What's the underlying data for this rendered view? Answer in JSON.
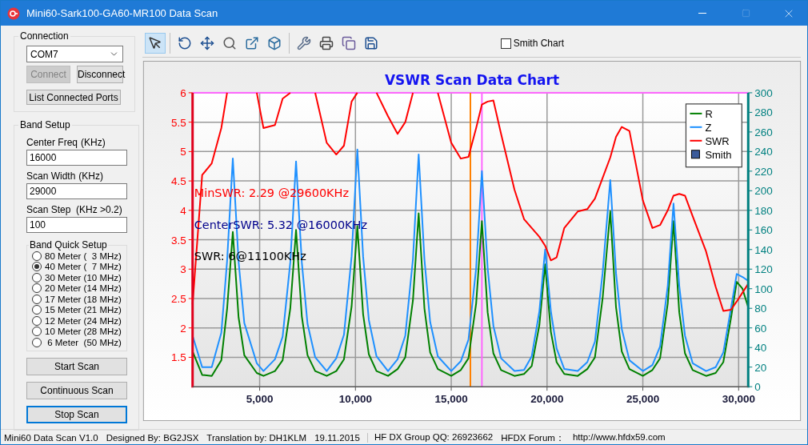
{
  "window": {
    "title": "Mini60-Sark100-GA60-MR100 Data Scan"
  },
  "connection": {
    "title": "Connection",
    "port": "COM7",
    "buttons": [
      {
        "label": "Connect",
        "disabled": true
      },
      {
        "label": "Disconnect",
        "disabled": false
      },
      {
        "label": "List Connected Ports",
        "disabled": false
      }
    ]
  },
  "band_setup": {
    "title": "Band Setup",
    "fields": [
      {
        "label": "Center Freq",
        "unit": "(KHz)",
        "value": "16000"
      },
      {
        "label": "Scan Width",
        "unit": "(KHz)",
        "value": "29000"
      },
      {
        "label": "Scan Step",
        "unit": "(KHz >0.2)",
        "value": "100"
      }
    ],
    "quick_setup": {
      "title": "Band Quick Setup",
      "options": [
        {
          "label": "80 Meter (  3 MHz)",
          "selected": false
        },
        {
          "label": "40 Meter (  7 MHz)",
          "selected": true
        },
        {
          "label": "30 Meter (10 MHz)",
          "selected": false
        },
        {
          "label": "20 Meter (14 MHz)",
          "selected": false
        },
        {
          "label": "17 Meter (18 MHz)",
          "selected": false
        },
        {
          "label": "15 Meter (21 MHz)",
          "selected": false
        },
        {
          "label": "12 Meter (24 MHz)",
          "selected": false
        },
        {
          "label": "10 Meter (28 MHz)",
          "selected": false
        },
        {
          "label": " 6 Meter  (50 MHz)",
          "selected": false
        }
      ]
    },
    "buttons": [
      {
        "label": "Start Scan",
        "focused": false
      },
      {
        "label": "Continuous Scan",
        "focused": false
      },
      {
        "label": "Stop Scan",
        "focused": true
      }
    ]
  },
  "toolbar": {
    "tools": [
      {
        "kind": "pointer",
        "selected": true
      },
      {
        "kind": "rotate",
        "selected": false
      },
      {
        "kind": "move",
        "selected": false
      },
      {
        "kind": "zoom",
        "selected": false
      },
      {
        "kind": "box-arrow",
        "selected": false
      },
      {
        "kind": "box",
        "selected": false
      },
      {
        "kind": "tools",
        "selected": false
      },
      {
        "kind": "print",
        "selected": false
      },
      {
        "kind": "copy",
        "selected": false
      },
      {
        "kind": "save",
        "selected": false
      }
    ],
    "smith_chart": {
      "label": "Smith Chart",
      "checked": false
    }
  },
  "chart": {
    "legend_extra": [
      {
        "label": "Smith",
        "color": "#3b5b9a"
      }
    ],
    "annotation_styles": [
      {
        "color": "#ff0000"
      },
      {
        "color": "#00008b"
      },
      {
        "color": "#000000"
      }
    ],
    "chart_data": {
      "type": "line",
      "title": "VSWR Scan Data Chart",
      "grid": true,
      "legend": "upper right",
      "ref_lines": [
        {
          "axis": "y",
          "value": 6,
          "color": "#ff66ff"
        },
        {
          "axis": "x",
          "value": 16000,
          "color": "#ff8000"
        },
        {
          "axis": "x",
          "value": 16600,
          "color": "#ff66ff"
        }
      ],
      "xlim": [
        1500,
        30500
      ],
      "ylim": [
        1,
        6
      ],
      "y2lim": [
        0,
        300
      ],
      "xticks": [
        {
          "value": 5000,
          "label": "5,000"
        },
        {
          "value": 10000,
          "label": "10,000"
        },
        {
          "value": 15000,
          "label": "15,000"
        },
        {
          "value": 20000,
          "label": "20,000"
        },
        {
          "value": 25000,
          "label": "25,000"
        },
        {
          "value": 30000,
          "label": "30,000"
        }
      ],
      "yticks": [
        1.5,
        2,
        2.5,
        3,
        3.5,
        4,
        4.5,
        5,
        5.5,
        6
      ],
      "y2ticks": [
        0,
        20,
        40,
        60,
        80,
        100,
        120,
        140,
        160,
        180,
        200,
        220,
        240,
        260,
        280,
        300
      ],
      "x": [
        1500,
        2000,
        2500,
        3000,
        3300,
        3600,
        3900,
        4200,
        4850,
        5200,
        5800,
        6200,
        6600,
        6900,
        7200,
        7500,
        7900,
        8500,
        9000,
        9400,
        9800,
        10100,
        10400,
        10700,
        11100,
        11700,
        12200,
        12600,
        13000,
        13300,
        13600,
        13900,
        14300,
        15000,
        15500,
        15900,
        16300,
        16600,
        16900,
        17200,
        17600,
        18300,
        18800,
        19200,
        19600,
        19900,
        20200,
        20500,
        20900,
        21600,
        22100,
        22500,
        22900,
        23300,
        23600,
        23900,
        24300,
        25000,
        25500,
        25900,
        26300,
        26600,
        26900,
        27200,
        27600,
        28300,
        28800,
        29200,
        29600,
        29900,
        30200,
        30500
      ],
      "series": [
        {
          "name": "R",
          "color": "#008000",
          "axis": "y2",
          "values": [
            36,
            12,
            11,
            27,
            79,
            158,
            71,
            32,
            14,
            11,
            16,
            27,
            80,
            160,
            72,
            32,
            16,
            11,
            16,
            28,
            82,
            164,
            74,
            33,
            16,
            11,
            18,
            30,
            88,
            177,
            80,
            35,
            18,
            11,
            17,
            29,
            85,
            169,
            76,
            34,
            17,
            11,
            13,
            21,
            63,
            125,
            56,
            25,
            13,
            11,
            18,
            30,
            90,
            179,
            81,
            36,
            18,
            11,
            17,
            29,
            85,
            169,
            76,
            34,
            17,
            11,
            14,
            25,
            70,
            107,
            100,
            81
          ]
        },
        {
          "name": "Z",
          "color": "#1e90ff",
          "axis": "y2",
          "values": [
            52,
            20,
            20,
            55,
            128,
            233,
            128,
            65,
            24,
            16,
            28,
            51,
            127,
            230,
            127,
            64,
            30,
            16,
            29,
            53,
            133,
            242,
            133,
            68,
            31,
            16,
            28,
            52,
            130,
            237,
            130,
            66,
            31,
            16,
            26,
            48,
            121,
            220,
            121,
            62,
            29,
            16,
            17,
            31,
            77,
            140,
            77,
            39,
            18,
            16,
            25,
            46,
            116,
            211,
            116,
            59,
            27,
            16,
            22,
            41,
            103,
            187,
            103,
            52,
            24,
            16,
            20,
            35,
            80,
            115,
            112,
            108
          ]
        },
        {
          "name": "SWR",
          "color": "#ff0000",
          "values": [
            2.4,
            4.6,
            4.8,
            5.4,
            6.0,
            null,
            null,
            null,
            6.0,
            5.4,
            5.45,
            5.9,
            6.0,
            null,
            null,
            null,
            6.0,
            5.15,
            4.95,
            5.1,
            5.85,
            6.0,
            null,
            null,
            6.0,
            5.6,
            5.3,
            5.5,
            6.0,
            null,
            null,
            null,
            6.0,
            5.15,
            4.88,
            4.91,
            5.4,
            5.8,
            5.85,
            5.87,
            5.3,
            4.35,
            3.85,
            3.7,
            3.55,
            3.4,
            3.15,
            3.2,
            3.7,
            3.98,
            4.02,
            4.2,
            4.55,
            4.9,
            5.25,
            5.42,
            5.35,
            4.17,
            3.7,
            3.75,
            4.0,
            4.25,
            4.28,
            4.25,
            3.9,
            3.3,
            2.7,
            2.29,
            2.31,
            2.45,
            2.6,
            2.75
          ]
        }
      ],
      "annotations": [
        "MinSWR: 2.29 @29600KHz",
        "CenterSWR: 5.32 @16000KHz",
        "SWR: 6@11100KHz"
      ]
    }
  },
  "status_bar": {
    "panels": [
      {
        "items": [
          "Mini60 Data Scan V1.0",
          "Designed By: BG2JSX",
          "Translation by: DH1KLM",
          "19.11.2015"
        ]
      },
      {
        "items": [
          "HF DX Group QQ: 26923662",
          "HFDX Forum：",
          "http://www.hfdx59.com"
        ]
      }
    ]
  }
}
